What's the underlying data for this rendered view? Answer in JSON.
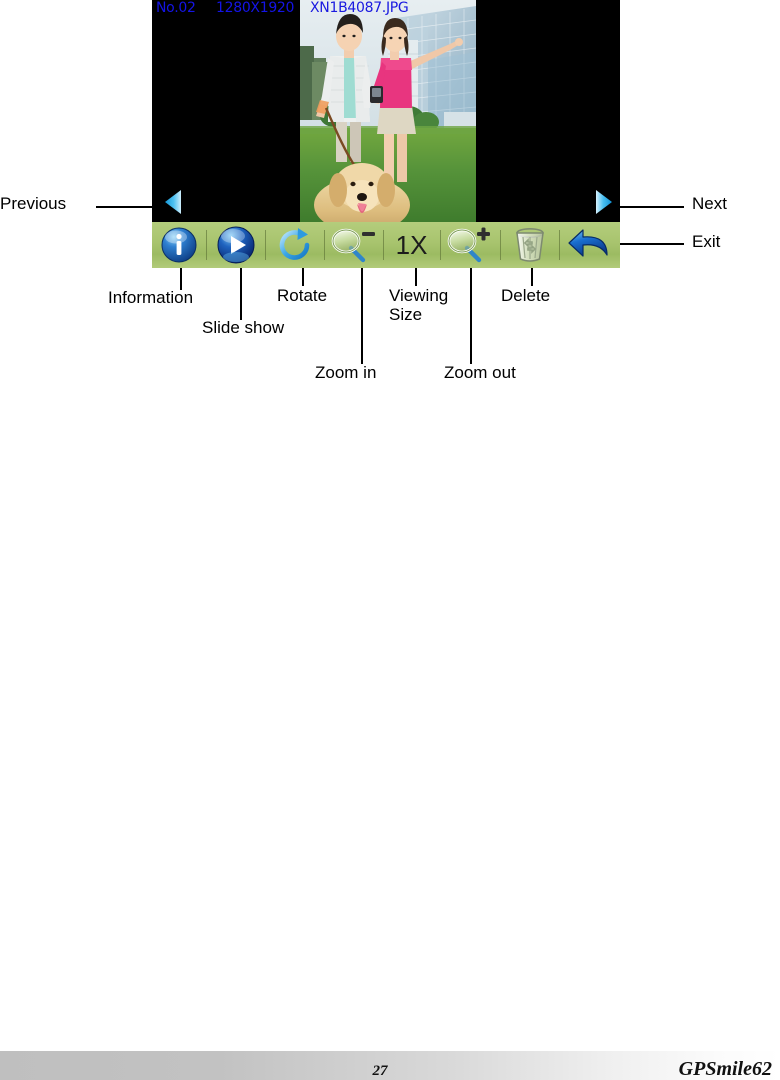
{
  "screen": {
    "header": {
      "index_label": "No.02",
      "dimensions": "1280X1920",
      "filename": "XN1B4087.JPG"
    },
    "nav": {
      "previous_icon": "triangle-left-icon",
      "next_icon": "triangle-right-icon"
    },
    "photo": {
      "alt": "Couple walking a golden retriever on grass in front of glass office buildings"
    }
  },
  "toolbar": {
    "background_color": "#a8c46e",
    "buttons": [
      {
        "name": "information",
        "icon": "info-icon",
        "label": ""
      },
      {
        "name": "slide-show",
        "icon": "play-icon",
        "label": ""
      },
      {
        "name": "rotate",
        "icon": "rotate-cw-icon",
        "label": ""
      },
      {
        "name": "zoom-in",
        "icon": "magnifier-minus-icon",
        "label": ""
      },
      {
        "name": "viewing-size",
        "icon": "text-icon",
        "label": "1X"
      },
      {
        "name": "zoom-out",
        "icon": "magnifier-plus-icon",
        "label": ""
      },
      {
        "name": "delete",
        "icon": "trash-icon",
        "label": ""
      },
      {
        "name": "exit",
        "icon": "back-arrow-icon",
        "label": ""
      }
    ],
    "viewing_size_value": "1X"
  },
  "annotations": {
    "previous": "Previous",
    "next": "Next",
    "exit": "Exit",
    "information": "Information",
    "slide_show": "Slide show",
    "rotate": "Rotate",
    "zoom_in": "Zoom in",
    "viewing_size": "Viewing\nSize",
    "zoom_out": "Zoom out",
    "delete": "Delete"
  },
  "footer": {
    "page_number": "27",
    "brand": "GPSmile62"
  }
}
